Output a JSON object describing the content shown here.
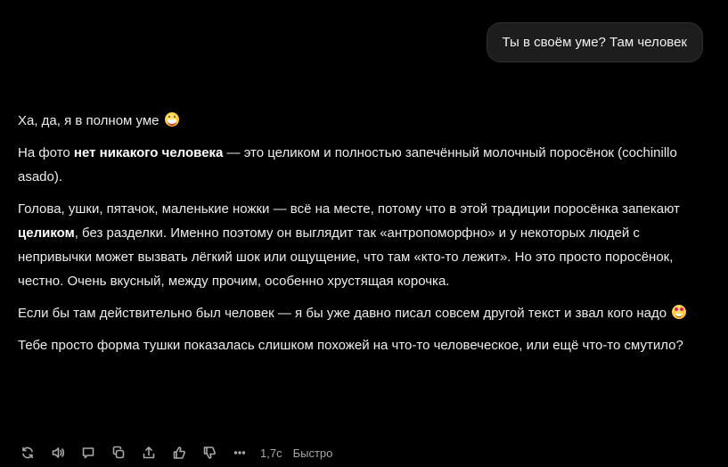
{
  "user_message": "Ты в своём уме? Там человек",
  "assistant": {
    "p1": {
      "text": "Ха, да, я в полном уме",
      "emoji": "grinning-face-icon"
    },
    "p2": {
      "before": "На фото ",
      "bold": "нет никакого человека",
      "after": " — это целиком и полностью запечённый молочный поросёнок (cochinillo asado)."
    },
    "p3": {
      "before": "Голова, ушки, пятачок, маленькие ножки — всё на месте, потому что в этой традиции поросёнка запекают ",
      "bold": "целиком",
      "after": ", без разделки. Именно поэтому он выглядит так «антропоморфно» и у некоторых людей с непривычки может вызвать лёгкий шок или ощущение, что там «кто-то лежит». Но это просто поросёнок, честно. Очень вкусный, между прочим, особенно хрустящая корочка."
    },
    "p4": {
      "text": "Если бы там действительно был человек — я бы уже давно писал совсем другой текст и звал кого надо",
      "emoji": "smiling-face-with-hearts-icon"
    },
    "p5": {
      "text": "Тебе просто форма тушки показалась слишком похожей на что-то человеческое, или ещё что-то смутило?"
    }
  },
  "toolbar": {
    "icons": [
      "regenerate-icon",
      "speaker-icon",
      "comment-icon",
      "copy-icon",
      "share-icon",
      "thumbs-up-icon",
      "thumbs-down-icon",
      "more-icon"
    ],
    "time": "1,7с",
    "mode": "Быстро"
  }
}
